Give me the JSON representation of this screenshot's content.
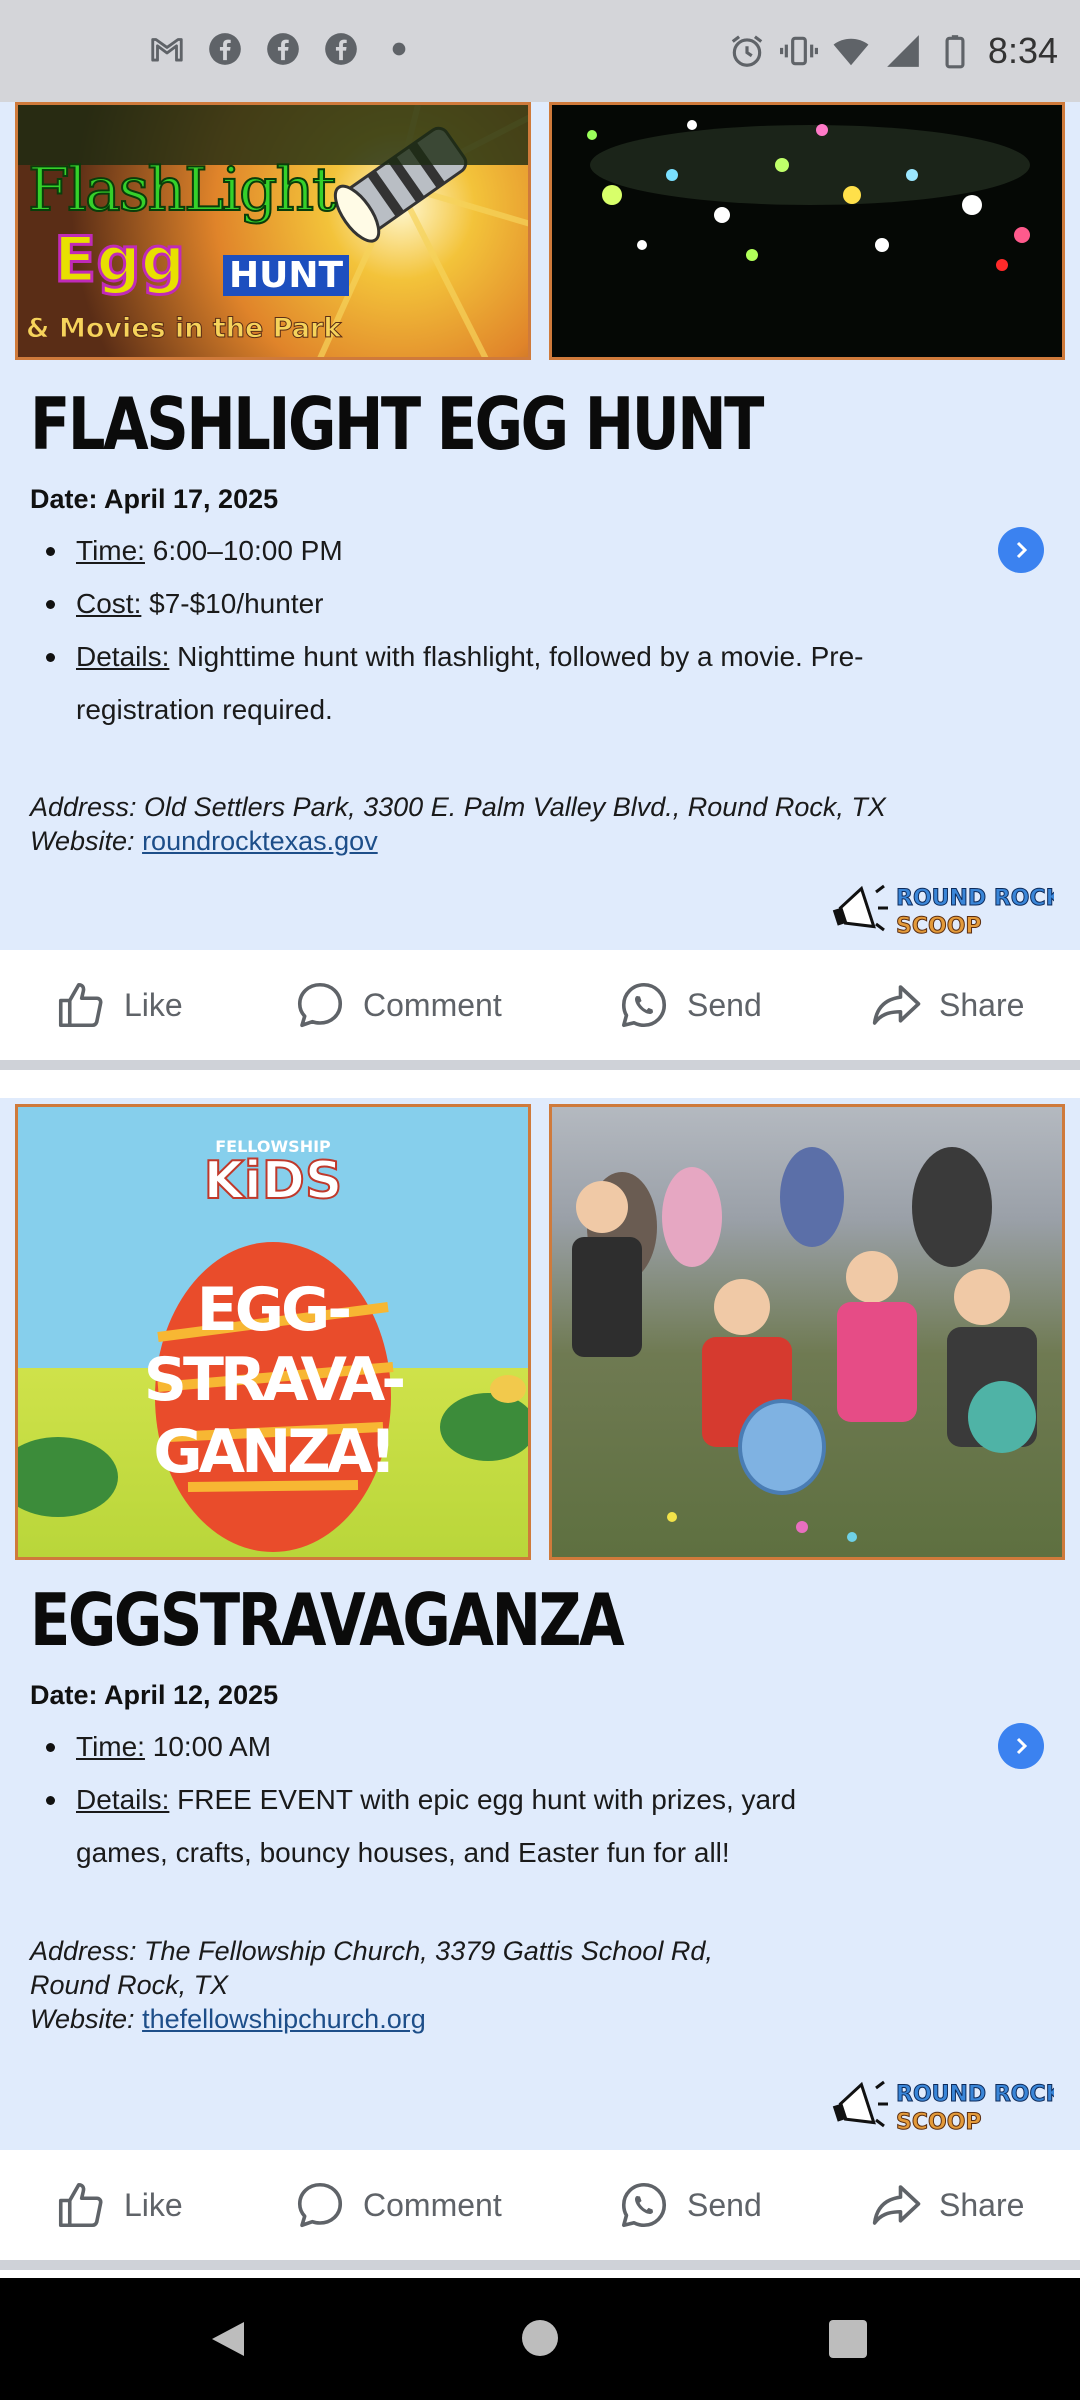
{
  "status_bar": {
    "time": "8:34",
    "left_icons": [
      "gmail-icon",
      "facebook-icon",
      "facebook-icon",
      "facebook-icon",
      "dot-icon"
    ],
    "right_icons": [
      "alarm-icon",
      "vibrate-icon",
      "wifi-icon",
      "signal-icon",
      "battery-icon"
    ]
  },
  "posts": [
    {
      "image1_text": {
        "line1": "FlashLight",
        "line2": "Egg",
        "line3": "HUNT",
        "line4": "& Movies in the Park"
      },
      "title": "FLASHLIGHT EGG HUNT",
      "date": "Date: April 17, 2025",
      "bullets": [
        {
          "label": "Time:",
          "value": " 6:00–10:00 PM"
        },
        {
          "label": "Cost:",
          "value": " $7-$10/hunter"
        },
        {
          "label": "Details:",
          "value": " Nighttime hunt with flashlight, followed by a movie. Pre-registration required."
        }
      ],
      "address": "Address: Old Settlers Park, 3300 E. Palm Valley Blvd., Round Rock, TX",
      "website_label": "Website: ",
      "website": "roundrocktexas.gov",
      "logo": {
        "line1": "ROUND ROCK",
        "line2": "SCOOP"
      }
    },
    {
      "image1_text": {
        "line0": "FELLOWSHIP",
        "line1": "KiDS",
        "line2": "EGG-",
        "line3": "STRAVA-",
        "line4": "GANZA!"
      },
      "title": "EGGSTRAVAGANZA",
      "date": "Date: April 12, 2025",
      "bullets": [
        {
          "label": "Time:",
          "value": " 10:00 AM"
        },
        {
          "label": "Details:",
          "value": " FREE EVENT with epic egg hunt with prizes, yard games, crafts, bouncy houses, and Easter fun for all!"
        }
      ],
      "address_line1": "Address: The Fellowship Church, 3379 Gattis School Rd,",
      "address_line2": "Round Rock, TX",
      "website_label": "Website: ",
      "website": "thefellowshipchurch.org",
      "logo": {
        "line1": "ROUND ROCK",
        "line2": "SCOOP"
      }
    }
  ],
  "actions": {
    "like": "Like",
    "comment": "Comment",
    "send": "Send",
    "share": "Share"
  },
  "colors": {
    "post_bg": "#e0ebfc",
    "accent_blue": "#3b82f0",
    "image_border": "#cf7a3b",
    "link": "#1d4e89"
  }
}
